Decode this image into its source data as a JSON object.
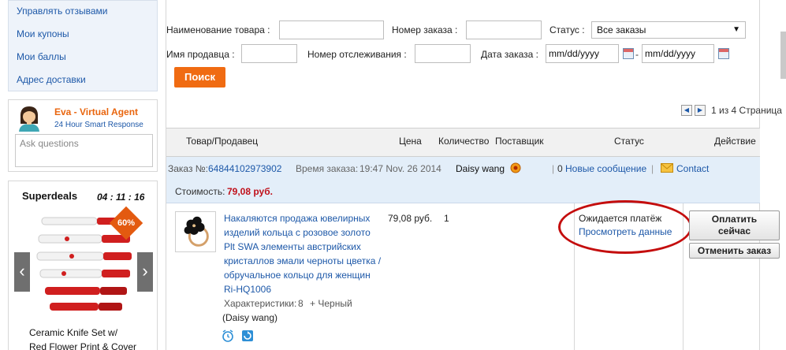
{
  "sidebar": {
    "menu": [
      "Управлять отзывами",
      "Мои купоны",
      "Мои баллы",
      "Адрес доставки"
    ],
    "agent": {
      "name": "Eva - Virtual Agent",
      "subtitle": "24 Hour Smart Response",
      "placeholder": "Ask questions"
    },
    "superdeals": {
      "title": "Superdeals",
      "timer": "04 : 11 : 16",
      "badge": "60%",
      "caption_line1": "Ceramic Knife Set w/",
      "caption_line2": "Red Flower Print & Cover"
    }
  },
  "filters": {
    "product_name_label": "Наименование товара :",
    "order_number_label": "Номер заказа :",
    "status_label": "Статус :",
    "status_value": "Все заказы",
    "seller_name_label": "Имя продавца :",
    "tracking_label": "Номер отслеживания :",
    "order_date_label": "Дата заказа :",
    "date_placeholder": "mm/dd/yyyy",
    "date_separator": "-",
    "search_button": "Поиск"
  },
  "pager": {
    "text": "1 из 4 Страница"
  },
  "table": {
    "headers": {
      "product": "Товар/Продавец",
      "price": "Цена",
      "qty": "Количество",
      "supplier": "Поставщик",
      "status": "Статус",
      "action": "Действие"
    }
  },
  "order": {
    "number_label": "Заказ №:",
    "number": "64844102973902",
    "time_label": "Время заказа:",
    "time": "19:47 Nov. 26 2014",
    "seller": "Daisy wang",
    "messages_count": "0",
    "messages_label": "Новые сообщение",
    "contact": "Contact",
    "cost_label": "Стоимость:",
    "cost": "79,08 руб.",
    "item": {
      "name_lines": [
        "Накаляются продажа ювелирных",
        "изделий кольца с розовое золото",
        "Plt SWA элементы австрийских",
        "кристаллов эмали черноты цветка /",
        "обручальное кольцо для женщин",
        "Ri-HQ1006"
      ],
      "price": "79,08 руб.",
      "quantity": "1",
      "specs_label": "Характеристики:",
      "specs_value": "8",
      "color": "+ Черный",
      "seller": "(Daisy wang)"
    },
    "status": "Ожидается платёж",
    "view_details": "Просмотреть данные",
    "pay_line1": "Оплатить",
    "pay_line2": "сейчас",
    "cancel": "Отменить заказ"
  },
  "colors": {
    "accent": "#f06b12",
    "link": "#1d58a8",
    "annotation": "#c40d0d",
    "price": "#c0101a"
  }
}
